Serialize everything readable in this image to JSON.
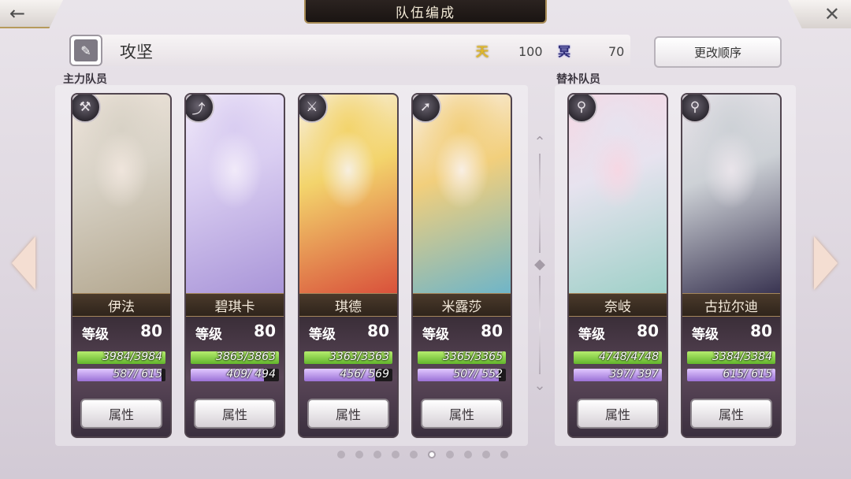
{
  "header": {
    "title": "队伍编成",
    "back_icon": "arrow-left-icon",
    "close_icon": "close-icon"
  },
  "team": {
    "name": "攻坚",
    "heaven_icon_label": "天",
    "heaven_value": "100",
    "underworld_icon_label": "冥",
    "underworld_value": "70",
    "order_button": "更改顺序"
  },
  "sections": {
    "main_label": "主力队员",
    "sub_label": "替补队员"
  },
  "level_label": "等级",
  "attr_label": "属性",
  "main_members": [
    {
      "name": "伊法",
      "class_icon": "hammer-icon",
      "level": "80",
      "hp": "3984/3984",
      "hp_frac": 1.0,
      "mp": "587/ 615",
      "mp_frac": 0.954,
      "portrait": [
        "#d8d2c6",
        "#b3a78f",
        "#efe5dc"
      ]
    },
    {
      "name": "碧琪卡",
      "class_icon": "bow-icon",
      "level": "80",
      "hp": "3863/3863",
      "hp_frac": 1.0,
      "mp": "409/ 494",
      "mp_frac": 0.828,
      "portrait": [
        "#d9cdf1",
        "#a995d8",
        "#f1eaf9"
      ]
    },
    {
      "name": "琪德",
      "class_icon": "sword-icon",
      "level": "80",
      "hp": "3363/3363",
      "hp_frac": 1.0,
      "mp": "456/ 569",
      "mp_frac": 0.801,
      "portrait": [
        "#f3d46c",
        "#d9513b",
        "#f7efe0"
      ]
    },
    {
      "name": "米露莎",
      "class_icon": "spear-icon",
      "level": "80",
      "hp": "3365/3365",
      "hp_frac": 1.0,
      "mp": "507/ 552",
      "mp_frac": 0.918,
      "portrait": [
        "#f2cf7c",
        "#6fb5c8",
        "#f9efe4"
      ]
    }
  ],
  "sub_members": [
    {
      "name": "奈岐",
      "class_icon": "staff-icon",
      "level": "80",
      "hp": "4748/4748",
      "hp_frac": 1.0,
      "mp": "397/ 397",
      "mp_frac": 1.0,
      "portrait": [
        "#e7e3ef",
        "#9fd0c8",
        "#f6d7e3"
      ]
    },
    {
      "name": "古拉尔迪",
      "class_icon": "staff-icon",
      "level": "80",
      "hp": "3384/3384",
      "hp_frac": 1.0,
      "mp": "615/ 615",
      "mp_frac": 1.0,
      "portrait": [
        "#cdd1d6",
        "#3a3552",
        "#e9e4ea"
      ]
    }
  ],
  "pagination": {
    "count": 10,
    "active": 5
  },
  "colors": {
    "hp": "#7fcf3f",
    "mp": "#b28ae6",
    "title_bg": "#1f1816",
    "gold": "#a88c55"
  }
}
